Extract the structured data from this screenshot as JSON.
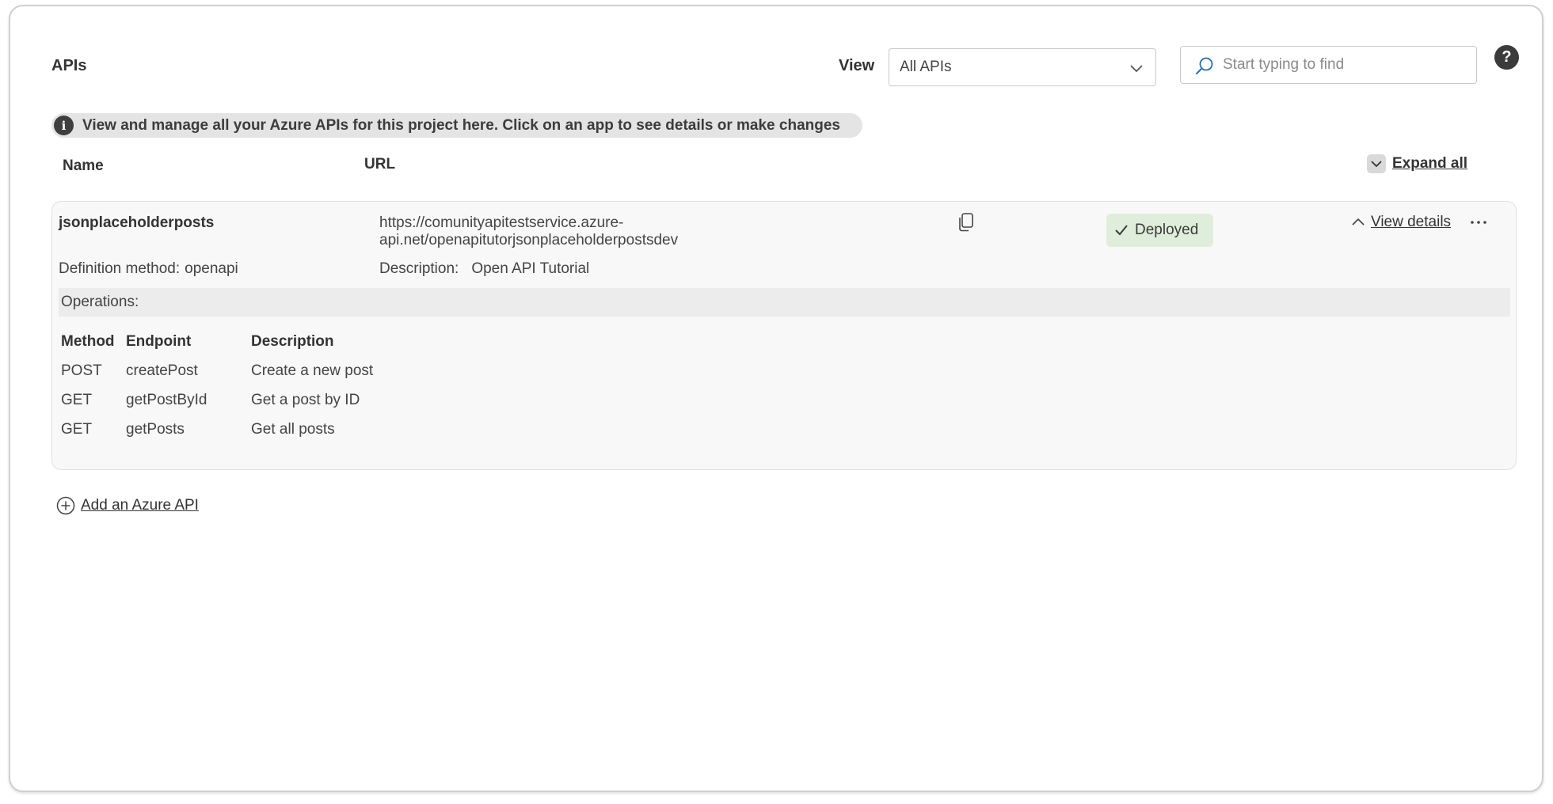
{
  "header": {
    "title": "APIs",
    "view_label": "View",
    "view_selected": "All APIs",
    "search_placeholder": "Start typing to find",
    "help_glyph": "?"
  },
  "info_banner": {
    "icon": "info-icon",
    "text": "View and manage all your Azure APIs for this project here. Click on an app to see details or make changes"
  },
  "columns": {
    "name": "Name",
    "url": "URL",
    "expand_all": "Expand all"
  },
  "apis": [
    {
      "name": "jsonplaceholderposts",
      "url_line1": "https://comunityapitestservice.azure-",
      "url_line2": "api.net/openapitutorjsonplaceholderpostsdev",
      "status": "Deployed",
      "status_color": "#dfeedb",
      "view_details": "View details",
      "definition_method_label": "Definition method:",
      "definition_method": "openapi",
      "description_label": "Description:",
      "description": "Open API Tutorial",
      "operations_label": "Operations:",
      "operations_headers": [
        "Method",
        "Endpoint",
        "Description"
      ],
      "operations": [
        {
          "method": "POST",
          "endpoint": "createPost",
          "description": "Create a new post"
        },
        {
          "method": "GET",
          "endpoint": "getPostById",
          "description": "Get a post by ID"
        },
        {
          "method": "GET",
          "endpoint": "getPosts",
          "description": "Get all posts"
        }
      ]
    }
  ],
  "actions": {
    "add_api": "Add an Azure API"
  }
}
